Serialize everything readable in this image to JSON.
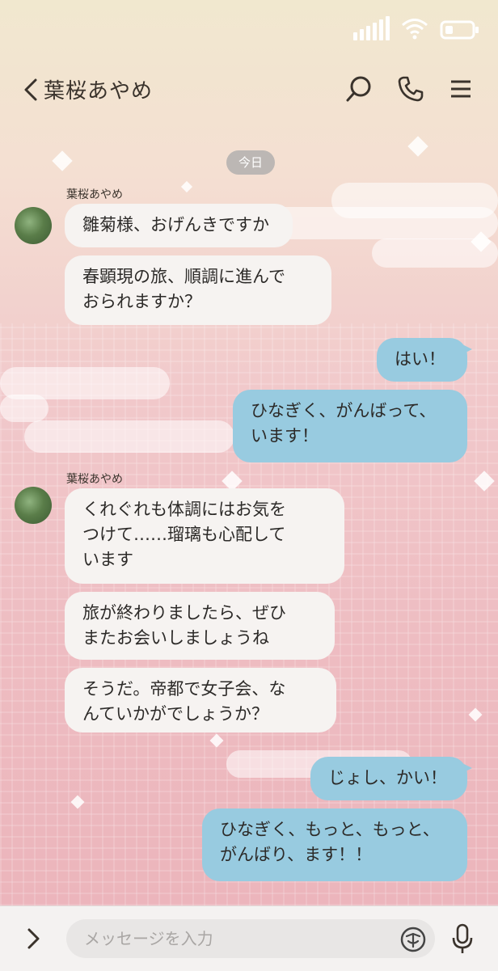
{
  "status_bar": {
    "icons": [
      "signal-icon",
      "wifi-icon",
      "battery-icon"
    ]
  },
  "header": {
    "title": "葉桜あやめ",
    "icons": [
      "back-icon",
      "search-icon",
      "phone-icon",
      "menu-icon"
    ]
  },
  "date_chip": "今日",
  "messages": [
    {
      "sender": "葉桜あやめ",
      "direction": "incoming",
      "texts": [
        "雛菊様、おげんきですか",
        "春顕現の旅、順調に進んで\nおられますか？"
      ]
    },
    {
      "direction": "outgoing",
      "texts": [
        "はい！",
        "ひなぎく、がんばって、\nいます！"
      ]
    },
    {
      "sender": "葉桜あやめ",
      "direction": "incoming",
      "texts": [
        "くれぐれも体調にはお気を\nつけて……瑠璃も心配して\nいます",
        "旅が終わりましたら、ぜひ\nまたお会いしましょうね",
        "そうだ。帝都で女子会、な\nんていかがでしょうか？"
      ]
    },
    {
      "direction": "outgoing",
      "texts": [
        "じょし、かい！",
        "ひなぎく、もっと、もっと、\nがんばり、ます！！"
      ]
    }
  ],
  "input_bar": {
    "placeholder": "メッセージを入力",
    "icons": [
      "expand-icon",
      "emoji-icon",
      "mic-icon"
    ]
  },
  "colors": {
    "outgoing_bubble": "#98cbe0",
    "incoming_bubble": "#f6f3f1",
    "date_chip": "#aaaaaa"
  }
}
